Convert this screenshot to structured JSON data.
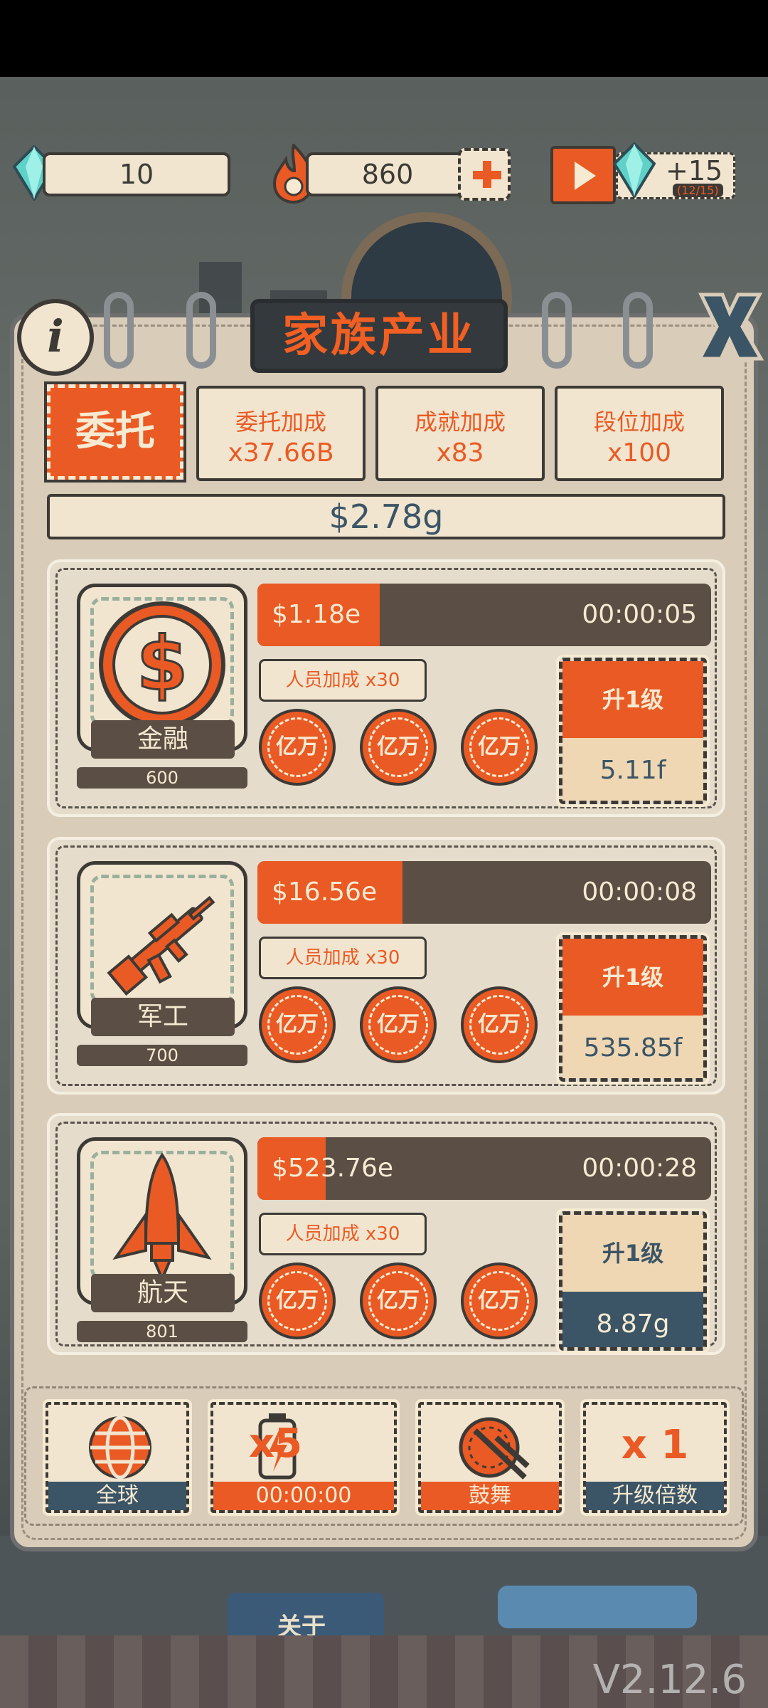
{
  "resources": {
    "diamonds": "10",
    "fire": "860",
    "video_bonus": "+15",
    "video_bonus_progress": "(12/15)"
  },
  "panel": {
    "title": "家族产业",
    "info_label": "i",
    "entrust_label": "委托",
    "bonuses": [
      {
        "title": "委托加成",
        "value": "x37.66B"
      },
      {
        "title": "成就加成",
        "value": "x83"
      },
      {
        "title": "段位加成",
        "value": "x100"
      }
    ],
    "total_income": "$2.78g"
  },
  "industries": [
    {
      "name": "金融",
      "icon": "dollar-coin-icon",
      "level": "600",
      "income": "$1.18e",
      "timer": "00:00:05",
      "progress": 0.27,
      "staff_bonus": "人员加成 x30",
      "coins": [
        "亿万",
        "亿万",
        "亿万"
      ],
      "upgrade_label": "升1级",
      "upgrade_cost": "5.11f",
      "upgrade_available": true
    },
    {
      "name": "军工",
      "icon": "rifle-icon",
      "level": "700",
      "income": "$16.56e",
      "timer": "00:00:08",
      "progress": 0.32,
      "staff_bonus": "人员加成 x30",
      "coins": [
        "亿万",
        "亿万",
        "亿万"
      ],
      "upgrade_label": "升1级",
      "upgrade_cost": "535.85f",
      "upgrade_available": true
    },
    {
      "name": "航天",
      "icon": "rocket-icon",
      "level": "801",
      "income": "$523.76e",
      "timer": "00:00:28",
      "progress": 0.15,
      "staff_bonus": "人员加成 x30",
      "coins": [
        "亿万",
        "亿万",
        "亿万"
      ],
      "upgrade_label": "升1级",
      "upgrade_cost": "8.87g",
      "upgrade_available": false
    }
  ],
  "toolbar": [
    {
      "label": "全球",
      "icon": "globe-icon"
    },
    {
      "label": "00:00:00",
      "big": "x5",
      "icon": "battery-icon"
    },
    {
      "label": "鼓舞",
      "icon": "drum-icon"
    },
    {
      "label": "升级倍数",
      "big": "x 1"
    }
  ],
  "background": {
    "bus_sign": "关于",
    "version": "V2.12.6"
  },
  "colors": {
    "accent": "#ea5a24",
    "cream": "#f1e5cf",
    "dark": "#3d3a36",
    "brown": "#5b4e44",
    "slate": "#3b5566"
  }
}
